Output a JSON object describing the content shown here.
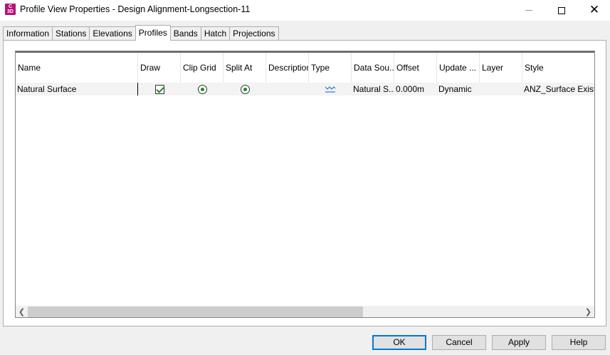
{
  "window": {
    "title": "Profile View Properties - Design Alignment-Longsection-11",
    "icon_letters": [
      "C",
      "3D"
    ],
    "icon_color": "#b5127a"
  },
  "tabs": [
    {
      "label": "Information",
      "active": false
    },
    {
      "label": "Stations",
      "active": false
    },
    {
      "label": "Elevations",
      "active": false
    },
    {
      "label": "Profiles",
      "active": true
    },
    {
      "label": "Bands",
      "active": false
    },
    {
      "label": "Hatch",
      "active": false
    },
    {
      "label": "Projections",
      "active": false
    }
  ],
  "grid": {
    "columns": [
      "Name",
      "Draw",
      "Clip Grid",
      "Split At",
      "Description",
      "Type",
      "Data Sou...",
      "Offset",
      "Update ...",
      "Layer",
      "Style"
    ],
    "rows": [
      {
        "name": "Natural Surface",
        "draw": true,
        "clip_grid": true,
        "split_at": true,
        "description": "",
        "type_icon": "surface-profile-icon",
        "data_source": "Natural S...",
        "offset": "0.000m",
        "update_mode": "Dynamic",
        "layer": "",
        "style": "ANZ_Surface Existing"
      }
    ]
  },
  "buttons": {
    "ok": "OK",
    "cancel": "Cancel",
    "apply": "Apply",
    "help": "Help"
  },
  "colors": {
    "accent_focus": "#0078d7",
    "check_green": "#1e8a1e",
    "type_icon_blue": "#2f7bd3"
  }
}
